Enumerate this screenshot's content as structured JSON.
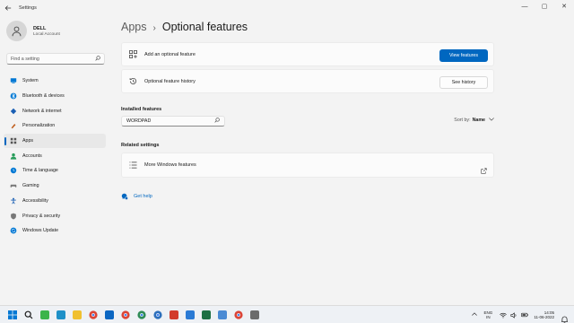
{
  "window": {
    "title": "Settings",
    "controls": {
      "minimize": "—",
      "maximize": "▢",
      "close": "✕"
    }
  },
  "profile": {
    "name": "DELL",
    "account": "Local Account"
  },
  "sidebar": {
    "search_placeholder": "Find a setting",
    "items": [
      {
        "label": "System",
        "icon": "system-icon",
        "color": "#0078d4"
      },
      {
        "label": "Bluetooth & devices",
        "icon": "bluetooth-icon",
        "color": "#0078d4"
      },
      {
        "label": "Network & internet",
        "icon": "network-icon",
        "color": "#1a5fb4"
      },
      {
        "label": "Personalization",
        "icon": "personalization-icon",
        "color": "#c06020"
      },
      {
        "label": "Apps",
        "icon": "apps-icon",
        "color": "#555555",
        "active": true
      },
      {
        "label": "Accounts",
        "icon": "accounts-icon",
        "color": "#2a9d5c"
      },
      {
        "label": "Time & language",
        "icon": "time-language-icon",
        "color": "#0078d4"
      },
      {
        "label": "Gaming",
        "icon": "gaming-icon",
        "color": "#777777"
      },
      {
        "label": "Accessibility",
        "icon": "accessibility-icon",
        "color": "#1a5fb4"
      },
      {
        "label": "Privacy & security",
        "icon": "privacy-icon",
        "color": "#777777"
      },
      {
        "label": "Windows Update",
        "icon": "windows-update-icon",
        "color": "#0078d4"
      }
    ]
  },
  "breadcrumb": {
    "parent": "Apps",
    "separator": "›",
    "current": "Optional features"
  },
  "cards": {
    "add": {
      "label": "Add an optional feature",
      "button": "View features"
    },
    "history": {
      "label": "Optional feature history",
      "button": "See history"
    }
  },
  "installed": {
    "title": "Installed features",
    "search_value": "WORDPAD",
    "sort_label": "Sort by:",
    "sort_value": "Name"
  },
  "related": {
    "title": "Related settings",
    "item": "More Windows features"
  },
  "help": {
    "label": "Get help"
  },
  "accent_color": "#0067c0",
  "taskbar": {
    "apps": [
      {
        "name": "start-icon",
        "color": "#0078d4"
      },
      {
        "name": "search-icon",
        "color": "#1a1a1a"
      },
      {
        "name": "camtasia-icon",
        "color": "#3bb44a"
      },
      {
        "name": "edge-icon",
        "color": "#1e90c8"
      },
      {
        "name": "file-explorer-icon",
        "color": "#f0c030"
      },
      {
        "name": "chrome-icon",
        "color": "#db4437"
      },
      {
        "name": "onedrive-icon",
        "color": "#0a66c2"
      },
      {
        "name": "chrome-profile-icon",
        "color": "#db4437"
      },
      {
        "name": "chrome-profile-2-icon",
        "color": "#2e8b57"
      },
      {
        "name": "chrome-profile-3-icon",
        "color": "#2c6fbb"
      },
      {
        "name": "ccleaner-icon",
        "color": "#d23b2b"
      },
      {
        "name": "image-viewer-icon",
        "color": "#2a7ad5"
      },
      {
        "name": "excel-icon",
        "color": "#1d7044"
      },
      {
        "name": "notepad-icon",
        "color": "#4a8ad4"
      },
      {
        "name": "chrome-profile-4-icon",
        "color": "#db4437"
      },
      {
        "name": "settings-icon",
        "color": "#6b6b6b"
      }
    ],
    "language": {
      "line1": "ENG",
      "line2": "IN"
    },
    "time": "14:05",
    "date": "11-06-2022"
  }
}
